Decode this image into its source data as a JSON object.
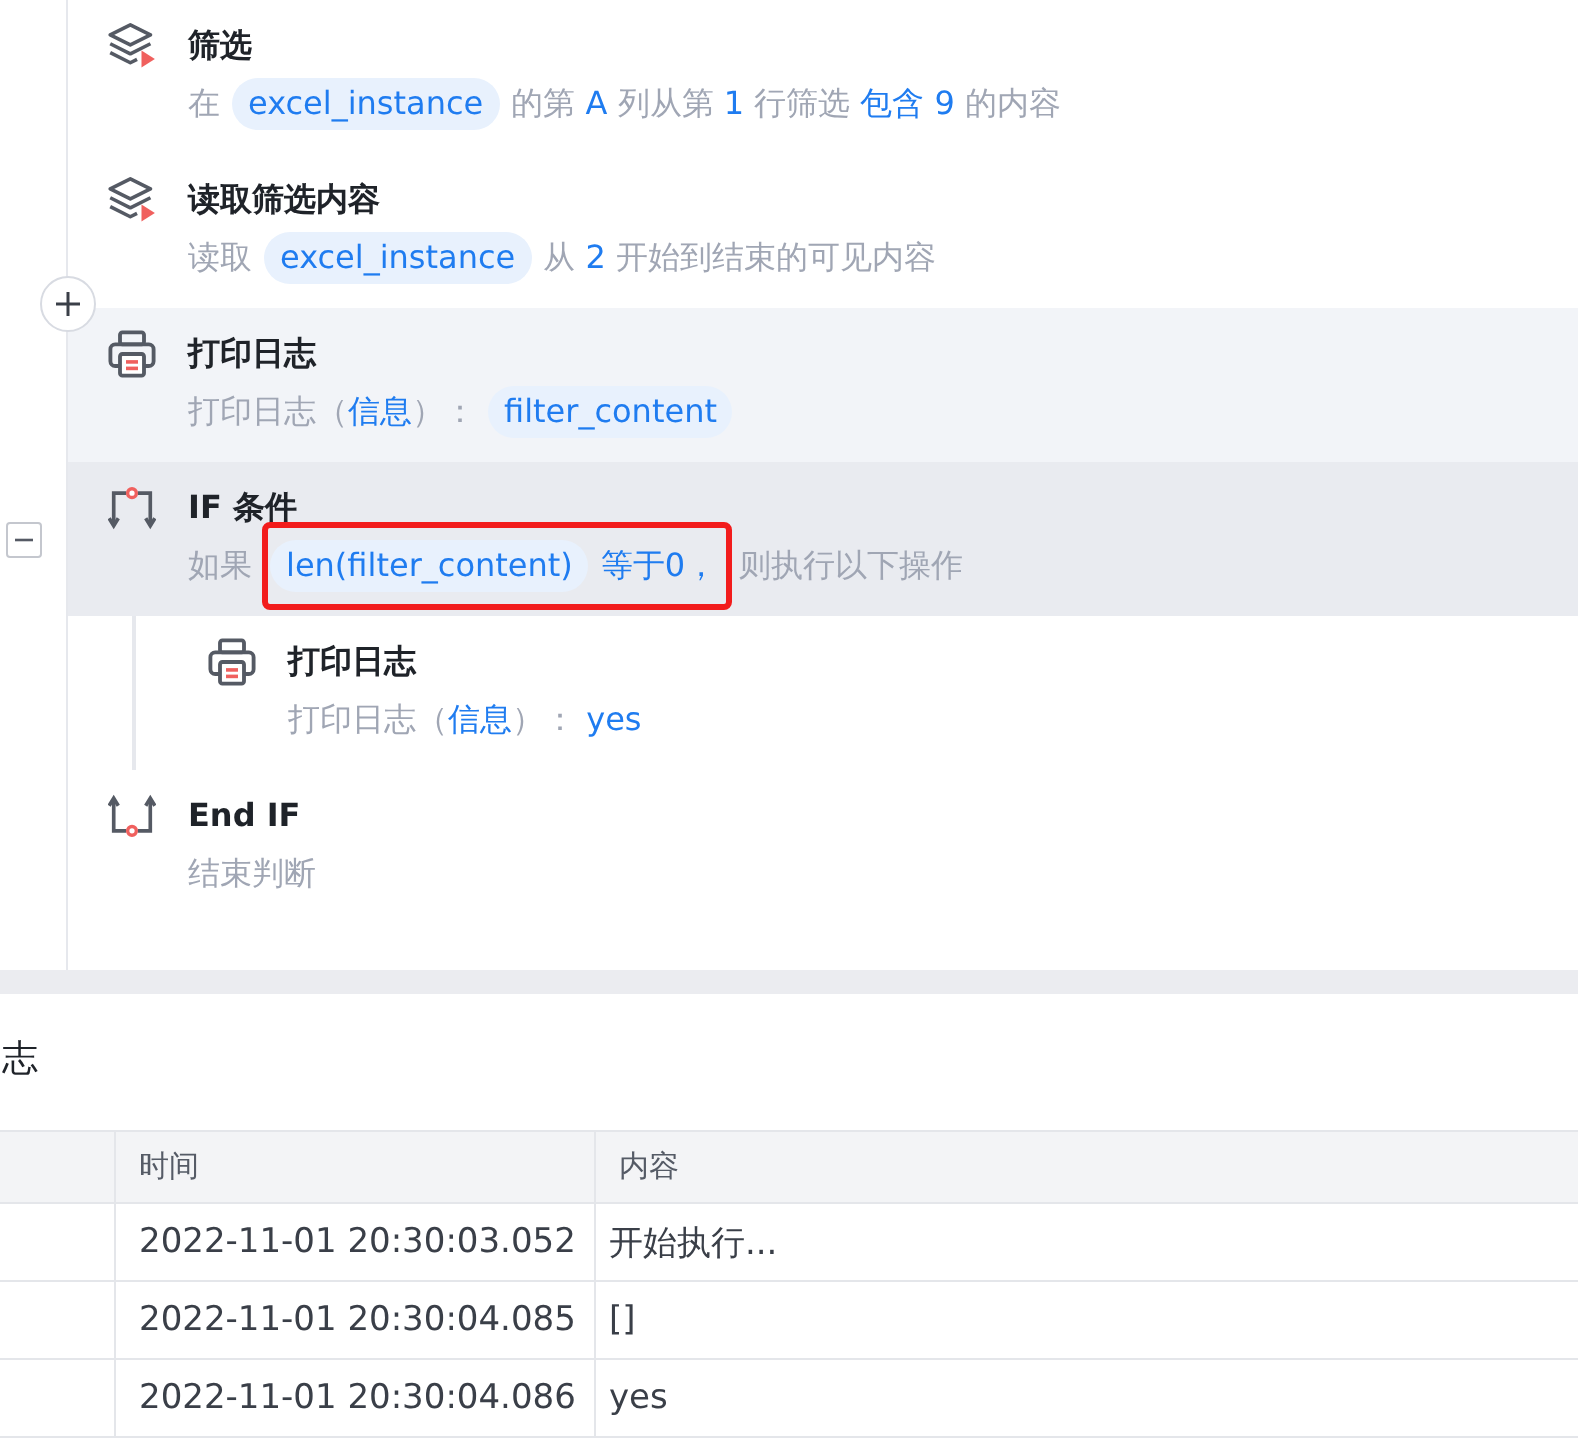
{
  "steps": [
    {
      "kind": "filter",
      "title": "筛选",
      "selected": false,
      "hovered": false,
      "description": [
        {
          "kind": "text",
          "text": "在"
        },
        {
          "kind": "variable",
          "text": "excel_instance"
        },
        {
          "kind": "text",
          "text": "的第 "
        },
        {
          "kind": "value",
          "text": "A"
        },
        {
          "kind": "text",
          "text": " 列从第 "
        },
        {
          "kind": "value",
          "text": "1"
        },
        {
          "kind": "text",
          "text": " 行筛选 "
        },
        {
          "kind": "value",
          "text": "包含 9"
        },
        {
          "kind": "text",
          "text": " 的内容"
        }
      ]
    },
    {
      "kind": "read",
      "title": "读取筛选内容",
      "selected": false,
      "hovered": false,
      "description": [
        {
          "kind": "text",
          "text": "读取"
        },
        {
          "kind": "variable",
          "text": "excel_instance"
        },
        {
          "kind": "text",
          "text": "从 "
        },
        {
          "kind": "value",
          "text": "2"
        },
        {
          "kind": "text",
          "text": " 开始到结束的可见内容"
        }
      ]
    },
    {
      "kind": "print",
      "title": "打印日志",
      "selected": false,
      "hovered": true,
      "description": [
        {
          "kind": "text",
          "text": "打印日志（"
        },
        {
          "kind": "value",
          "text": "信息"
        },
        {
          "kind": "text",
          "text": "）："
        },
        {
          "kind": "variable",
          "text": "filter_content"
        }
      ]
    },
    {
      "kind": "if",
      "title": "IF 条件",
      "selected": true,
      "hovered": false,
      "expanded": true,
      "description": [
        {
          "kind": "text",
          "text": "如果"
        },
        {
          "kind": "highlight",
          "children": [
            {
              "kind": "variable",
              "text": "len(filter_content)"
            },
            {
              "kind": "value",
              "text": "等于0，"
            }
          ]
        },
        {
          "kind": "text",
          "text": "则执行以下操作"
        }
      ],
      "children": [
        {
          "kind": "print",
          "title": "打印日志",
          "selected": false,
          "hovered": false,
          "description": [
            {
              "kind": "text",
              "text": "打印日志（"
            },
            {
              "kind": "value",
              "text": "信息"
            },
            {
              "kind": "text",
              "text": "）： "
            },
            {
              "kind": "value",
              "text": "yes"
            }
          ]
        }
      ]
    },
    {
      "kind": "endif",
      "title": "End IF",
      "selected": false,
      "hovered": false,
      "description": [
        {
          "kind": "text",
          "text": "结束判断"
        }
      ]
    }
  ],
  "log_panel": {
    "title": "志",
    "columns": [
      {
        "label": "时间"
      },
      {
        "label": "内容"
      }
    ],
    "rows": [
      {
        "time": "2022-11-01 20:30:03.052",
        "content": "开始执行..."
      },
      {
        "time": "2022-11-01 20:30:04.085",
        "content": "[]"
      },
      {
        "time": "2022-11-01 20:30:04.086",
        "content": "yes"
      }
    ]
  }
}
